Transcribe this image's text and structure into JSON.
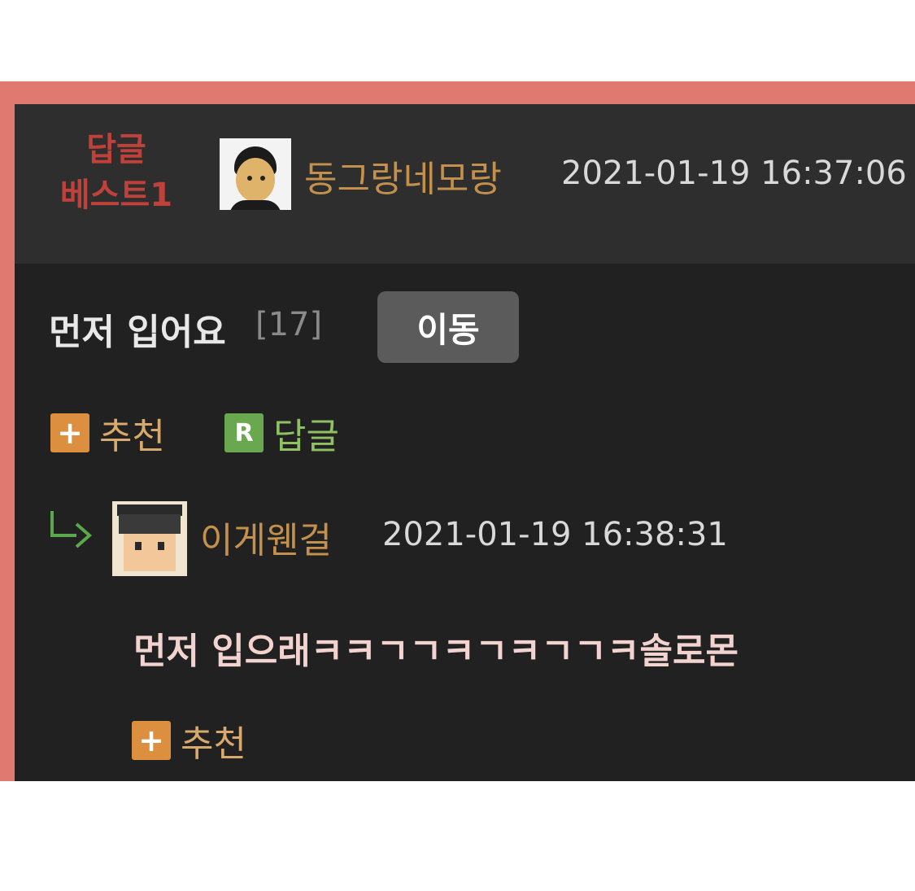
{
  "best_comment": {
    "badge_line1": "답글",
    "badge_line2": "베스트1",
    "author": "동그랑네모랑",
    "timestamp": "2021-01-19 16:37:06",
    "post_title": "먼저 입어요",
    "reply_count": "[17]",
    "move_button": "이동",
    "recommend_label": "추천",
    "reply_label": "답글",
    "recommend_icon": "+",
    "reply_icon": "R"
  },
  "reply": {
    "author": "이게웬걸",
    "timestamp": "2021-01-19 16:38:31",
    "text": "먼저 입으래ㅋㅋㄱㄱㅋㄱㅋㄱㄱㅋ솔로몬",
    "recommend_label": "추천",
    "recommend_icon": "+"
  },
  "colors": {
    "frame": "#e07a70",
    "background": "#212121",
    "header": "#2e2e2e",
    "badge": "#c0403a",
    "nickname": "#c4914c",
    "recommend": "#dc8f3e",
    "reply": "#6aa84f"
  },
  "icons": [
    "user-avatar-icon",
    "plus-icon",
    "reply-icon",
    "reply-arrow-icon"
  ]
}
